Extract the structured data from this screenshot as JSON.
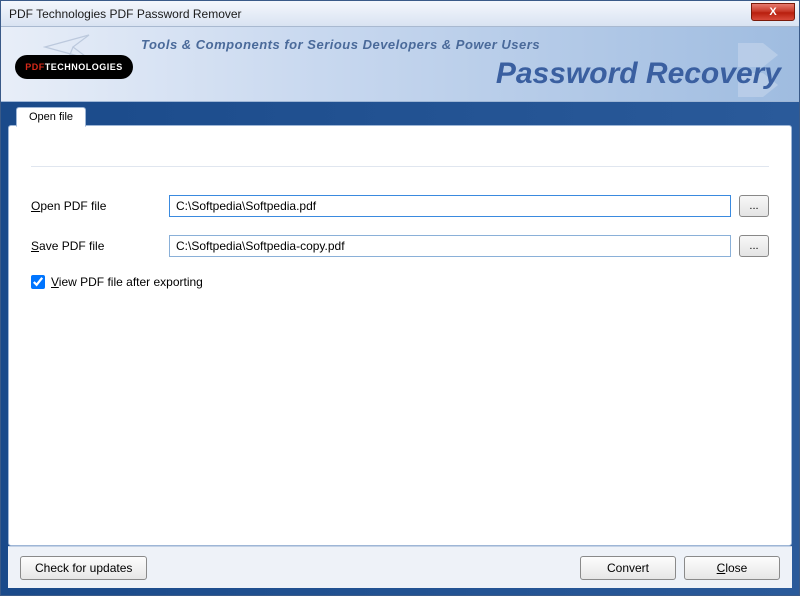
{
  "window": {
    "title": "PDF Technologies PDF Password Remover",
    "close_label": "X"
  },
  "banner": {
    "logo_brand_1": "PDF",
    "logo_brand_2": "TECHNOLOGIES",
    "tagline": "Tools & Components for Serious Developers & Power Users",
    "title": "Password Recovery"
  },
  "tabs": {
    "open_file": "Open file"
  },
  "form": {
    "open_label_pre": "O",
    "open_label_post": "pen PDF file",
    "open_value": "C:\\Softpedia\\Softpedia.pdf",
    "save_label_pre": "S",
    "save_label_post": "ave PDF file",
    "save_value": "C:\\Softpedia\\Softpedia-copy.pdf",
    "browse_label": "...",
    "view_checked": true,
    "view_label_pre": "V",
    "view_label_post": "iew PDF file after exporting"
  },
  "footer": {
    "check_updates": "Check for updates",
    "convert": "Convert",
    "close_pre": "C",
    "close_post": "lose"
  }
}
